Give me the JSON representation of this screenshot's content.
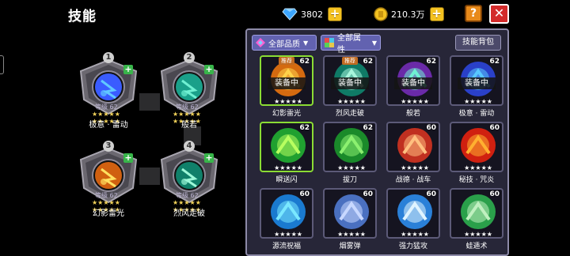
{
  "header": {
    "title": "技能",
    "gems": "3802",
    "coins": "210.3万",
    "help_label": "?",
    "close_label": "✕",
    "plus_label": "+"
  },
  "equipped_slots": [
    {
      "num": "1",
      "level": "等级 62",
      "stars": "★★★★★ ★★★★★",
      "name": "极意 · 雷动",
      "art_color": "#3a5cff",
      "art_accent": "#60c8ff"
    },
    {
      "num": "2",
      "level": "等级 62",
      "stars": "★★★★★ ★★★★★",
      "name": "般若",
      "art_color": "#1aa08a",
      "art_accent": "#6ff0d2"
    },
    {
      "num": "3",
      "level": "等级 62",
      "stars": "★★★★★ ★★★★★",
      "name": "幻影雷光",
      "art_color": "#d06010",
      "art_accent": "#ffe060"
    },
    {
      "num": "4",
      "level": "等级 62",
      "stars": "★★★★★ ★★★★★",
      "name": "烈风走破",
      "art_color": "#10806a",
      "art_accent": "#9cf8d8"
    }
  ],
  "panel": {
    "filter_quality": "全部品质",
    "filter_attr": "全部属性",
    "bag_button": "技能背包",
    "dropdown": "▼",
    "recommend_label": "推荐",
    "equipped_label": "装备中"
  },
  "skills": [
    {
      "name": "幻影雷光",
      "level": "62",
      "stars": "★★★★★",
      "recommend": true,
      "equipped": true,
      "art_color": "#d46a10",
      "art_accent": "#ffd24a",
      "highlight": true
    },
    {
      "name": "烈风走破",
      "level": "62",
      "stars": "★★★★★",
      "recommend": true,
      "equipped": true,
      "art_color": "#0f7a66",
      "art_accent": "#a8f5dc",
      "highlight": false
    },
    {
      "name": "般若",
      "level": "62",
      "stars": "★★★★★",
      "recommend": false,
      "equipped": true,
      "art_color": "#6a2aa8",
      "art_accent": "#6ff0d2",
      "highlight": false
    },
    {
      "name": "极意 · 雷动",
      "level": "62",
      "stars": "★★★★★",
      "recommend": false,
      "equipped": true,
      "art_color": "#2a40c8",
      "art_accent": "#58c8ff",
      "highlight": false
    },
    {
      "name": "瞬送闪",
      "level": "62",
      "stars": "★★★★★",
      "recommend": false,
      "equipped": false,
      "art_color": "#20a030",
      "art_accent": "#b8ff60",
      "highlight": true
    },
    {
      "name": "拔刀",
      "level": "62",
      "stars": "★★★★★",
      "recommend": false,
      "equipped": false,
      "art_color": "#1a8a2a",
      "art_accent": "#8cf070",
      "highlight": false
    },
    {
      "name": "战德 · 战车",
      "level": "60",
      "stars": "★★★★★",
      "recommend": false,
      "equipped": false,
      "art_color": "#c03020",
      "art_accent": "#ffc080",
      "highlight": false
    },
    {
      "name": "秘技 · 咒炎",
      "level": "60",
      "stars": "★★★★★",
      "recommend": false,
      "equipped": false,
      "art_color": "#d02010",
      "art_accent": "#ffb030",
      "highlight": false
    },
    {
      "name": "源流祝福",
      "level": "60",
      "stars": "★★★★★",
      "recommend": false,
      "equipped": false,
      "art_color": "#1a7ad0",
      "art_accent": "#7ae8ff",
      "highlight": false
    },
    {
      "name": "烟雾弹",
      "level": "60",
      "stars": "★★★★★",
      "recommend": false,
      "equipped": false,
      "art_color": "#4a70c0",
      "art_accent": "#c8d8ff",
      "highlight": false
    },
    {
      "name": "强力猛攻",
      "level": "60",
      "stars": "★★★★★",
      "recommend": false,
      "equipped": false,
      "art_color": "#2a80d8",
      "art_accent": "#e0f4ff",
      "highlight": false
    },
    {
      "name": "蛙遁术",
      "level": "60",
      "stars": "★★★★★",
      "recommend": false,
      "equipped": false,
      "art_color": "#2aa04a",
      "art_accent": "#c0f0c0",
      "highlight": false
    }
  ],
  "colors": {
    "panel_bg": "#272638",
    "filter_bg": "#6262b0",
    "gold": "#f4c220",
    "close_red": "#d32a2a",
    "help_orange": "#e88a1a",
    "highlight_green": "#8bdc34"
  }
}
